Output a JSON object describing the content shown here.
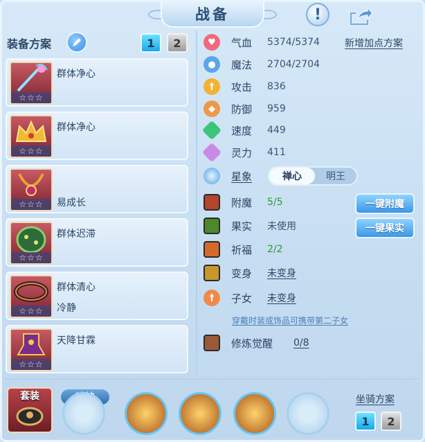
{
  "header": {
    "title": "战备",
    "help_icon": "exclamation-icon",
    "share_icon": "share-arrow-icon"
  },
  "left": {
    "title": "装备方案",
    "plans": [
      "1",
      "2"
    ],
    "active_plan": "1",
    "skills": [
      {
        "line1": "群体净心",
        "line2": "",
        "stars": "☆☆☆"
      },
      {
        "line1": "群体净心",
        "line2": "",
        "stars": "☆☆☆"
      },
      {
        "line1": "",
        "line2": "易成长",
        "stars": "☆☆☆"
      },
      {
        "line1": "群体迟滞",
        "line2": "",
        "stars": "☆☆☆"
      },
      {
        "line1": "群体清心",
        "line2": "冷静",
        "stars": "☆☆☆"
      },
      {
        "line1": "天降甘霖",
        "line2": "",
        "stars": "☆☆☆"
      }
    ]
  },
  "stats": {
    "new_points": "新增加点方案",
    "hp": {
      "label": "气血",
      "value": "5374/5374"
    },
    "mp": {
      "label": "魔法",
      "value": "2704/2704"
    },
    "atk": {
      "label": "攻击",
      "value": "836"
    },
    "def": {
      "label": "防御",
      "value": "959"
    },
    "spd": {
      "label": "速度",
      "value": "449"
    },
    "spi": {
      "label": "灵力",
      "value": "411"
    },
    "star": {
      "label": "星象",
      "options": [
        "禅心",
        "明王"
      ],
      "selected": "禅心"
    }
  },
  "extras": {
    "enchant": {
      "label": "附魔",
      "value": "5/5",
      "button": "一键附魔"
    },
    "fruit": {
      "label": "果实",
      "value": "未使用",
      "button": "一键果实"
    },
    "bless": {
      "label": "祈福",
      "value": "2/2"
    },
    "transform": {
      "label": "变身",
      "value": "未变身"
    },
    "child": {
      "label": "子女",
      "value": "未变身"
    },
    "hint": "穿戴时装或饰品可携带第二子女",
    "awaken": {
      "label": "修炼觉醒",
      "value": "0/8"
    }
  },
  "bottom": {
    "set_label": "套装",
    "soul_label": "魂技",
    "mount_title": "坐骑方案",
    "mount_plans": [
      "1",
      "2"
    ],
    "active_mount": "1"
  },
  "colors": {
    "accent": "#1aa8e6",
    "green_value": "#2b9a3a",
    "panel": "#c6ddf1"
  }
}
